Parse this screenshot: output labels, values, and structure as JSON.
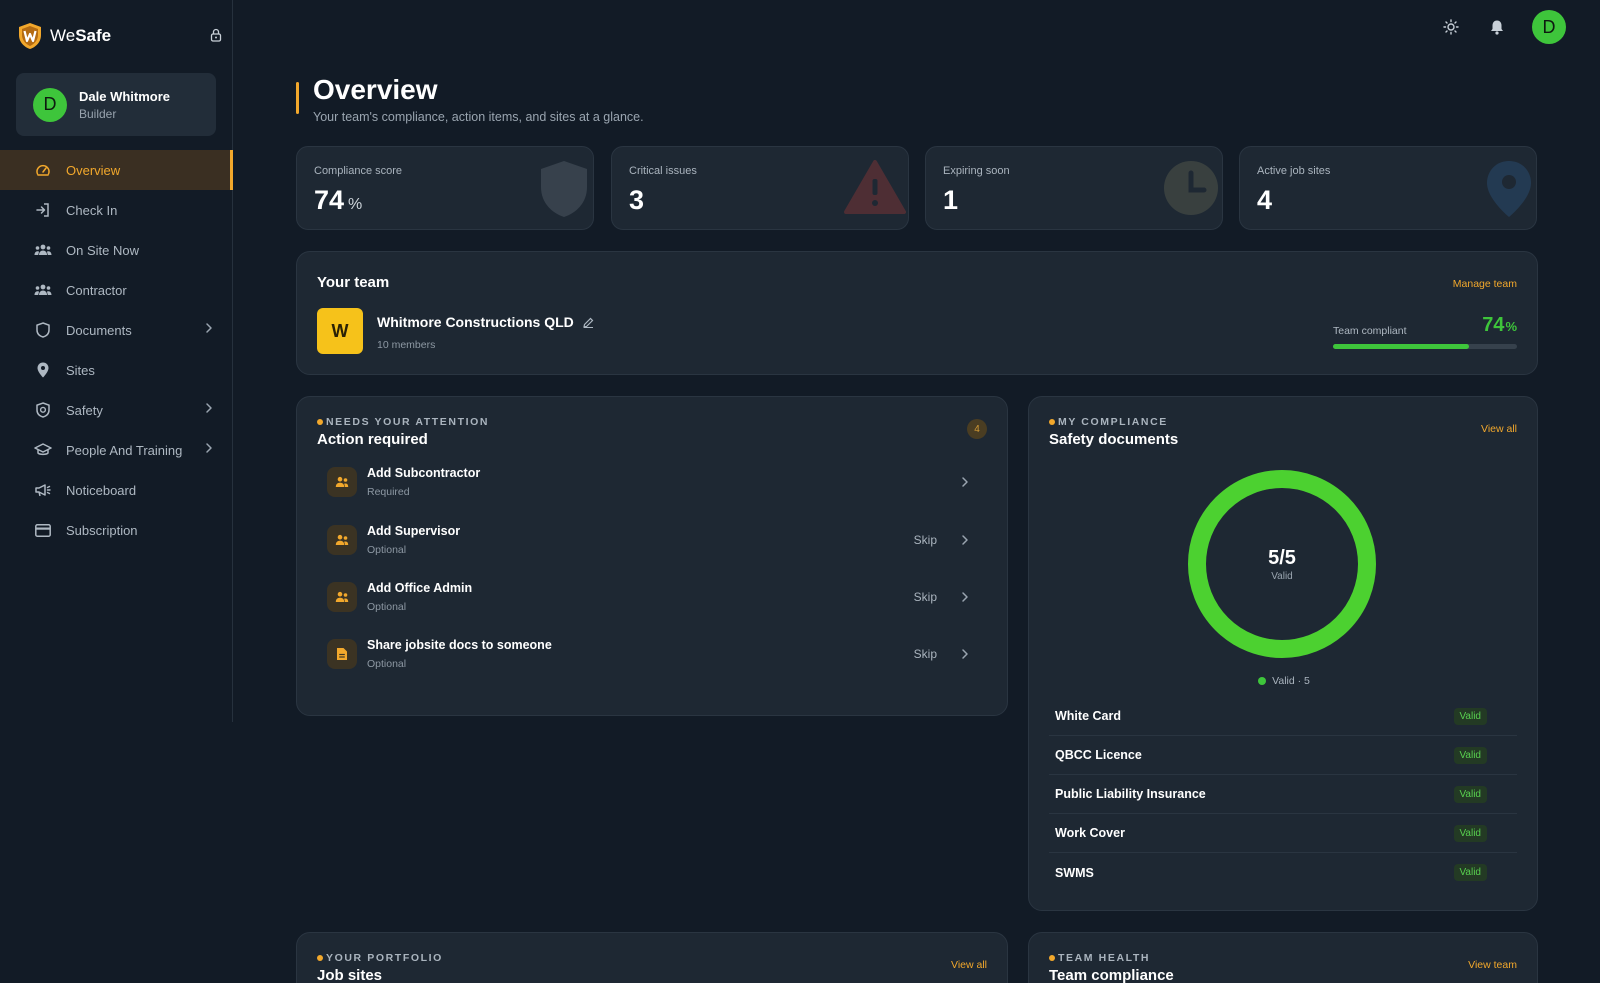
{
  "brand": {
    "name_light": "We",
    "name_bold": "Safe"
  },
  "user": {
    "initial": "D",
    "name": "Dale Whitmore",
    "role": "Builder"
  },
  "nav": [
    {
      "label": "Overview",
      "icon": "gauge-icon",
      "active": true,
      "chevron": false
    },
    {
      "label": "Check In",
      "icon": "check-in-icon",
      "active": false,
      "chevron": false
    },
    {
      "label": "On Site Now",
      "icon": "people-group-icon",
      "active": false,
      "chevron": false
    },
    {
      "label": "Contractor",
      "icon": "people-group-icon",
      "active": false,
      "chevron": false
    },
    {
      "label": "Documents",
      "icon": "shield-icon",
      "active": false,
      "chevron": true
    },
    {
      "label": "Sites",
      "icon": "map-pin-icon",
      "active": false,
      "chevron": false
    },
    {
      "label": "Safety",
      "icon": "shield-check-icon",
      "active": false,
      "chevron": true
    },
    {
      "label": "People And Training",
      "icon": "graduation-cap-icon",
      "active": false,
      "chevron": true
    },
    {
      "label": "Noticeboard",
      "icon": "megaphone-icon",
      "active": false,
      "chevron": false
    },
    {
      "label": "Subscription",
      "icon": "credit-card-icon",
      "active": false,
      "chevron": false
    }
  ],
  "topbar": {
    "avatar_initial": "D"
  },
  "header": {
    "title": "Overview",
    "subtitle": "Your team's compliance, action items, and sites at a glance."
  },
  "stats": [
    {
      "label": "Compliance score",
      "value": "74",
      "unit": "%",
      "icon": "shield-icon"
    },
    {
      "label": "Critical issues",
      "value": "3",
      "unit": "",
      "icon": "warning-icon"
    },
    {
      "label": "Expiring soon",
      "value": "1",
      "unit": "",
      "icon": "clock-icon"
    },
    {
      "label": "Active job sites",
      "value": "4",
      "unit": "",
      "icon": "map-pin-icon"
    }
  ],
  "team": {
    "title": "Your team",
    "manage_label": "Manage team",
    "logo_letter": "W",
    "name": "Whitmore Constructions QLD",
    "members": "10 members",
    "compliant_label": "Team compliant",
    "compliant_value": "74",
    "compliant_unit": "%",
    "compliant_fraction": 0.74
  },
  "actions": {
    "kicker": "NEEDS YOUR ATTENTION",
    "title": "Action required",
    "count": "4",
    "items": [
      {
        "title": "Add Subcontractor",
        "status": "Required",
        "skip": "",
        "icon": "people-icon"
      },
      {
        "title": "Add Supervisor",
        "status": "Optional",
        "skip": "Skip",
        "icon": "people-icon"
      },
      {
        "title": "Add Office Admin",
        "status": "Optional",
        "skip": "Skip",
        "icon": "people-icon"
      },
      {
        "title": "Share jobsite docs to someone",
        "status": "Optional",
        "skip": "Skip",
        "icon": "document-icon"
      }
    ]
  },
  "compliance": {
    "kicker": "MY COMPLIANCE",
    "title": "Safety documents",
    "view_all": "View all",
    "donut_value": "5/5",
    "donut_label": "Valid",
    "legend": "Valid · 5",
    "valid_fraction": 1,
    "docs": [
      {
        "name": "White Card",
        "status": "Valid"
      },
      {
        "name": "QBCC Licence",
        "status": "Valid"
      },
      {
        "name": "Public Liability Insurance",
        "status": "Valid"
      },
      {
        "name": "Work Cover",
        "status": "Valid"
      },
      {
        "name": "SWMS",
        "status": "Valid"
      }
    ]
  },
  "portfolio": {
    "kicker": "YOUR PORTFOLIO",
    "title": "Job sites",
    "link": "View all"
  },
  "team_health": {
    "kicker": "TEAM HEALTH",
    "title": "Team compliance",
    "link": "View team"
  },
  "colors": {
    "accent": "#f2a82c",
    "success": "#3ec53b",
    "background": "#121b26",
    "card": "#1e2833"
  }
}
